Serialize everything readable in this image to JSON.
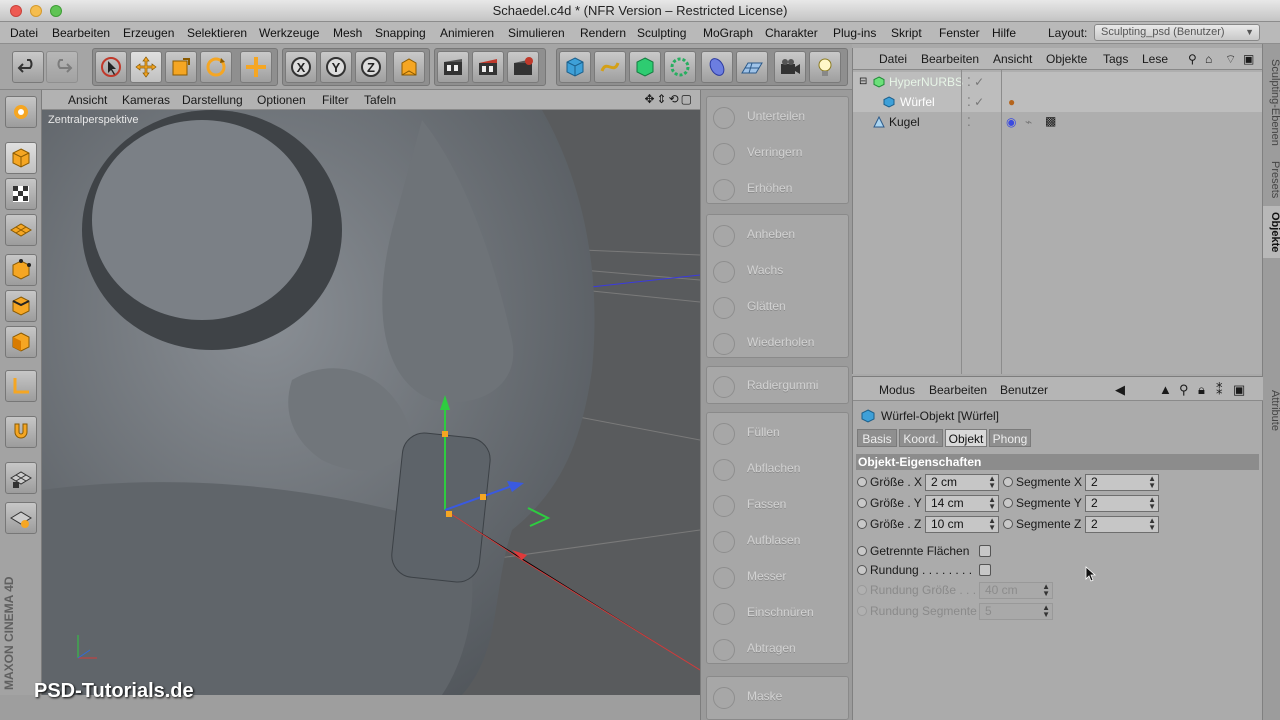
{
  "window": {
    "title": "Schaedel.c4d * (NFR Version – Restricted License)"
  },
  "menubar": {
    "items": [
      "Datei",
      "Bearbeiten",
      "Erzeugen",
      "Selektieren",
      "Werkzeuge",
      "Mesh",
      "Snapping",
      "Animieren",
      "Simulieren",
      "Rendern",
      "Sculpting",
      "MoGraph",
      "Charakter",
      "Plug-ins",
      "Skript",
      "Fenster",
      "Hilfe"
    ],
    "layout_label": "Layout:",
    "layout_value": "Sculpting_psd (Benutzer)"
  },
  "toolbar": {
    "icons": [
      "undo-icon",
      "redo-icon",
      "live-selection-icon",
      "move-icon",
      "scale-icon",
      "rotate-icon",
      "recent-tool-icon",
      "x-axis-icon",
      "y-axis-icon",
      "z-axis-icon",
      "coordinate-system-icon",
      "render-view-icon",
      "render-picture-viewer-icon",
      "render-settings-icon",
      "cube-primitive-icon",
      "spline-pen-icon",
      "nurbs-icon",
      "array-icon",
      "deformer-icon",
      "floor-icon",
      "camera-icon",
      "light-icon"
    ]
  },
  "viewport": {
    "menu": [
      "Ansicht",
      "Kameras",
      "Darstellung",
      "Optionen",
      "Filter",
      "Tafeln"
    ],
    "camera_label": "Zentralperspektive",
    "watermark": "PSD-Tutorials.de",
    "logo": "MAXON CINEMA 4D"
  },
  "brushes": {
    "groups": [
      [
        "Unterteilen",
        "Verringern",
        "Erhöhen"
      ],
      [
        "Anheben",
        "Wachs",
        "Glätten",
        "Wiederholen"
      ],
      [
        "Radiergummi"
      ],
      [
        "Füllen",
        "Abflachen",
        "Fassen",
        "Aufblasen",
        "Messer",
        "Einschnüren",
        "Abtragen"
      ],
      [
        "Maske"
      ]
    ]
  },
  "objects": {
    "menu": [
      "Datei",
      "Bearbeiten",
      "Ansicht",
      "Objekte",
      "Tags",
      "Lese"
    ],
    "items": [
      {
        "name": "HyperNURBS",
        "indent": 0,
        "selected": true,
        "color": "#d9f0d9"
      },
      {
        "name": "Würfel",
        "indent": 1,
        "selected": true,
        "color": "#ffffff"
      },
      {
        "name": "Kugel",
        "indent": 0,
        "selected": false,
        "color": "#111111"
      }
    ]
  },
  "right_tabs": [
    "Sculpting-Ebenen",
    "Presets",
    "Objekte",
    "Attribute"
  ],
  "attributes": {
    "menu": [
      "Modus",
      "Bearbeiten",
      "Benutzer"
    ],
    "title": "Würfel-Objekt [Würfel]",
    "tabs": [
      "Basis",
      "Koord.",
      "Objekt",
      "Phong"
    ],
    "active_tab": "Objekt",
    "section": "Objekt-Eigenschaften",
    "size": [
      {
        "label": "Größe . X",
        "value": "2 cm"
      },
      {
        "label": "Größe . Y",
        "value": "14 cm"
      },
      {
        "label": "Größe . Z",
        "value": "10 cm"
      }
    ],
    "segments": [
      {
        "label": "Segmente X",
        "value": "2"
      },
      {
        "label": "Segmente Y",
        "value": "2"
      },
      {
        "label": "Segmente Z",
        "value": "2"
      }
    ],
    "separate_faces": "Getrennte Flächen",
    "fillet": "Rundung . . . . . . . .",
    "fillet_size_label": "Rundung Größe . . .",
    "fillet_size_value": "40 cm",
    "fillet_segments_label": "Rundung Segmente",
    "fillet_segments_value": "5"
  }
}
